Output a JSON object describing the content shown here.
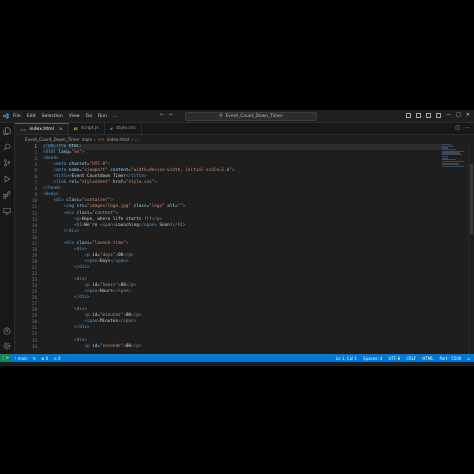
{
  "titlebar": {
    "menu": [
      "File",
      "Edit",
      "Selection",
      "View",
      "Go",
      "Run",
      "…"
    ],
    "nav_back": "←",
    "nav_forward": "→",
    "command_center": "Event_Count_Down_Timer"
  },
  "tabs": [
    {
      "label": "index.html",
      "icon": "<>",
      "icon_color": "#e37933",
      "active": true
    },
    {
      "label": "script.js",
      "icon": "JS",
      "icon_color": "#d4bf3a",
      "active": false
    },
    {
      "label": "style.css",
      "icon": "#",
      "icon_color": "#519aba",
      "active": false
    }
  ],
  "tab_close": "×",
  "breadcrumbs": [
    "Event_Count_Down_Timer",
    "main",
    "›",
    "<>",
    "index.html",
    "›",
    "..."
  ],
  "line_numbers": [
    "1",
    "2",
    "3",
    "4",
    "5",
    "6",
    "7",
    "8",
    "9",
    "10",
    "11",
    "12",
    "13",
    "14",
    "15",
    "16",
    "17",
    "18",
    "19",
    "20",
    "21",
    "22",
    "23",
    "24",
    "25",
    "26",
    "27",
    "28",
    "29",
    "30",
    "31",
    "32",
    "33",
    "34"
  ],
  "current_line": 1,
  "code": [
    [
      [
        "t-punc",
        "<!"
      ],
      [
        "t-tag",
        "DOCTYPE"
      ],
      [
        "t-attr",
        " html"
      ],
      [
        "t-punc",
        ">"
      ]
    ],
    [
      [
        "t-punc",
        "<"
      ],
      [
        "t-tag",
        "html"
      ],
      [
        "t-attr",
        " lang"
      ],
      [
        "t-txt",
        "="
      ],
      [
        "t-str",
        "\"en\""
      ],
      [
        "t-punc",
        ">"
      ]
    ],
    [
      [
        "t-punc",
        "<"
      ],
      [
        "t-tag",
        "head"
      ],
      [
        "t-punc",
        ">"
      ]
    ],
    [
      [
        "t-txt",
        "    "
      ],
      [
        "t-punc",
        "<"
      ],
      [
        "t-tag",
        "meta"
      ],
      [
        "t-attr",
        " charset"
      ],
      [
        "t-txt",
        "="
      ],
      [
        "t-str",
        "\"UTF-8\""
      ],
      [
        "t-punc",
        ">"
      ]
    ],
    [
      [
        "t-txt",
        "    "
      ],
      [
        "t-punc",
        "<"
      ],
      [
        "t-tag",
        "meta"
      ],
      [
        "t-attr",
        " name"
      ],
      [
        "t-txt",
        "="
      ],
      [
        "t-str",
        "\"viewport\""
      ],
      [
        "t-attr",
        " content"
      ],
      [
        "t-txt",
        "="
      ],
      [
        "t-str",
        "\"width=device-width, initial-scale=1.0\""
      ],
      [
        "t-punc",
        ">"
      ]
    ],
    [
      [
        "t-txt",
        "    "
      ],
      [
        "t-punc",
        "<"
      ],
      [
        "t-tag",
        "title"
      ],
      [
        "t-punc",
        ">"
      ],
      [
        "t-txt",
        "Event Countdown Timer"
      ],
      [
        "t-punc",
        "</"
      ],
      [
        "t-tag",
        "title"
      ],
      [
        "t-punc",
        ">"
      ]
    ],
    [
      [
        "t-txt",
        "    "
      ],
      [
        "t-punc",
        "<"
      ],
      [
        "t-tag",
        "link"
      ],
      [
        "t-attr",
        " rel"
      ],
      [
        "t-txt",
        "="
      ],
      [
        "t-str",
        "\"stylesheet\""
      ],
      [
        "t-attr",
        " href"
      ],
      [
        "t-txt",
        "="
      ],
      [
        "t-str",
        "\"style.css\""
      ],
      [
        "t-punc",
        ">"
      ]
    ],
    [
      [
        "t-punc",
        "</"
      ],
      [
        "t-tag",
        "head"
      ],
      [
        "t-punc",
        ">"
      ]
    ],
    [
      [
        "t-punc",
        "<"
      ],
      [
        "t-tag",
        "body"
      ],
      [
        "t-punc",
        ">"
      ]
    ],
    [
      [
        "t-txt",
        "    "
      ],
      [
        "t-punc",
        "<"
      ],
      [
        "t-tag",
        "div"
      ],
      [
        "t-attr",
        " class"
      ],
      [
        "t-txt",
        "="
      ],
      [
        "t-str",
        "\"container\""
      ],
      [
        "t-punc",
        ">"
      ]
    ],
    [
      [
        "t-txt",
        "        "
      ],
      [
        "t-punc",
        "<"
      ],
      [
        "t-tag",
        "img"
      ],
      [
        "t-attr",
        " src"
      ],
      [
        "t-txt",
        "="
      ],
      [
        "t-str",
        "\"images/logo.jpg\""
      ],
      [
        "t-attr",
        " class"
      ],
      [
        "t-txt",
        "="
      ],
      [
        "t-str",
        "\"logo\""
      ],
      [
        "t-attr",
        " alt"
      ],
      [
        "t-txt",
        "="
      ],
      [
        "t-str",
        "\"\""
      ],
      [
        "t-punc",
        ">"
      ]
    ],
    [
      [
        "t-txt",
        "        "
      ],
      [
        "t-punc",
        "<"
      ],
      [
        "t-tag",
        "div"
      ],
      [
        "t-attr",
        " class"
      ],
      [
        "t-txt",
        "="
      ],
      [
        "t-str",
        "\"content\""
      ],
      [
        "t-punc",
        ">"
      ]
    ],
    [
      [
        "t-txt",
        "            "
      ],
      [
        "t-punc",
        "<"
      ],
      [
        "t-tag",
        "p"
      ],
      [
        "t-punc",
        ">"
      ],
      [
        "t-txt",
        "Hope, where life starts !!!"
      ],
      [
        "t-punc",
        "</"
      ],
      [
        "t-tag",
        "p"
      ],
      [
        "t-punc",
        ">"
      ]
    ],
    [
      [
        "t-txt",
        "            "
      ],
      [
        "t-punc",
        "<"
      ],
      [
        "t-tag",
        "h1"
      ],
      [
        "t-punc",
        ">"
      ],
      [
        "t-txt",
        "We're "
      ],
      [
        "t-punc",
        "<"
      ],
      [
        "t-tag",
        "span"
      ],
      [
        "t-punc",
        ">"
      ],
      [
        "t-txt",
        "Launching"
      ],
      [
        "t-punc",
        "</"
      ],
      [
        "t-tag",
        "span"
      ],
      [
        "t-punc",
        ">"
      ],
      [
        "t-txt",
        " Soon!"
      ],
      [
        "t-punc",
        "</"
      ],
      [
        "t-tag",
        "h1"
      ],
      [
        "t-punc",
        ">"
      ]
    ],
    [
      [
        "t-txt",
        "        "
      ],
      [
        "t-punc",
        "</"
      ],
      [
        "t-tag",
        "div"
      ],
      [
        "t-punc",
        ">"
      ]
    ],
    [
      [
        "t-txt",
        ""
      ]
    ],
    [
      [
        "t-txt",
        "        "
      ],
      [
        "t-punc",
        "<"
      ],
      [
        "t-tag",
        "div"
      ],
      [
        "t-attr",
        " class"
      ],
      [
        "t-txt",
        "="
      ],
      [
        "t-str",
        "\"launch-time\""
      ],
      [
        "t-punc",
        ">"
      ]
    ],
    [
      [
        "t-txt",
        "            "
      ],
      [
        "t-punc",
        "<"
      ],
      [
        "t-tag",
        "div"
      ],
      [
        "t-punc",
        ">"
      ]
    ],
    [
      [
        "t-txt",
        "                "
      ],
      [
        "t-punc",
        "<"
      ],
      [
        "t-tag",
        "p"
      ],
      [
        "t-attr",
        " id"
      ],
      [
        "t-txt",
        "="
      ],
      [
        "t-str",
        "\"days\""
      ],
      [
        "t-punc",
        ">"
      ],
      [
        "t-txt",
        "00"
      ],
      [
        "t-punc",
        "</"
      ],
      [
        "t-tag",
        "p"
      ],
      [
        "t-punc",
        ">"
      ]
    ],
    [
      [
        "t-txt",
        "                "
      ],
      [
        "t-punc",
        "<"
      ],
      [
        "t-tag",
        "span"
      ],
      [
        "t-punc",
        ">"
      ],
      [
        "t-txt",
        "Days"
      ],
      [
        "t-punc",
        "</"
      ],
      [
        "t-tag",
        "span"
      ],
      [
        "t-punc",
        ">"
      ]
    ],
    [
      [
        "t-txt",
        "            "
      ],
      [
        "t-punc",
        "</"
      ],
      [
        "t-tag",
        "div"
      ],
      [
        "t-punc",
        ">"
      ]
    ],
    [
      [
        "t-txt",
        ""
      ]
    ],
    [
      [
        "t-txt",
        "            "
      ],
      [
        "t-punc",
        "<"
      ],
      [
        "t-tag",
        "div"
      ],
      [
        "t-punc",
        ">"
      ]
    ],
    [
      [
        "t-txt",
        "                "
      ],
      [
        "t-punc",
        "<"
      ],
      [
        "t-tag",
        "p"
      ],
      [
        "t-attr",
        " id"
      ],
      [
        "t-txt",
        "="
      ],
      [
        "t-str",
        "\"hours\""
      ],
      [
        "t-punc",
        ">"
      ],
      [
        "t-txt",
        "00"
      ],
      [
        "t-punc",
        "</"
      ],
      [
        "t-tag",
        "p"
      ],
      [
        "t-punc",
        ">"
      ]
    ],
    [
      [
        "t-txt",
        "                "
      ],
      [
        "t-punc",
        "<"
      ],
      [
        "t-tag",
        "span"
      ],
      [
        "t-punc",
        ">"
      ],
      [
        "t-txt",
        "Hours"
      ],
      [
        "t-punc",
        "</"
      ],
      [
        "t-tag",
        "span"
      ],
      [
        "t-punc",
        ">"
      ]
    ],
    [
      [
        "t-txt",
        "            "
      ],
      [
        "t-punc",
        "</"
      ],
      [
        "t-tag",
        "div"
      ],
      [
        "t-punc",
        ">"
      ]
    ],
    [
      [
        "t-txt",
        ""
      ]
    ],
    [
      [
        "t-txt",
        "            "
      ],
      [
        "t-punc",
        "<"
      ],
      [
        "t-tag",
        "div"
      ],
      [
        "t-punc",
        ">"
      ]
    ],
    [
      [
        "t-txt",
        "                "
      ],
      [
        "t-punc",
        "<"
      ],
      [
        "t-tag",
        "p"
      ],
      [
        "t-attr",
        " id"
      ],
      [
        "t-txt",
        "="
      ],
      [
        "t-str",
        "\"minutes\""
      ],
      [
        "t-punc",
        ">"
      ],
      [
        "t-txt",
        "00"
      ],
      [
        "t-punc",
        "</"
      ],
      [
        "t-tag",
        "p"
      ],
      [
        "t-punc",
        ">"
      ]
    ],
    [
      [
        "t-txt",
        "                "
      ],
      [
        "t-punc",
        "<"
      ],
      [
        "t-tag",
        "span"
      ],
      [
        "t-punc",
        ">"
      ],
      [
        "t-txt",
        "Minutes"
      ],
      [
        "t-punc",
        "</"
      ],
      [
        "t-tag",
        "span"
      ],
      [
        "t-punc",
        ">"
      ]
    ],
    [
      [
        "t-txt",
        "            "
      ],
      [
        "t-punc",
        "</"
      ],
      [
        "t-tag",
        "div"
      ],
      [
        "t-punc",
        ">"
      ]
    ],
    [
      [
        "t-txt",
        ""
      ]
    ],
    [
      [
        "t-txt",
        "            "
      ],
      [
        "t-punc",
        "<"
      ],
      [
        "t-tag",
        "div"
      ],
      [
        "t-punc",
        ">"
      ]
    ],
    [
      [
        "t-txt",
        "                "
      ],
      [
        "t-punc",
        "<"
      ],
      [
        "t-tag",
        "p"
      ],
      [
        "t-attr",
        " id"
      ],
      [
        "t-txt",
        "="
      ],
      [
        "t-str",
        "\"seconds\""
      ],
      [
        "t-punc",
        ">"
      ],
      [
        "t-txt",
        "00"
      ],
      [
        "t-punc",
        "</"
      ],
      [
        "t-tag",
        "p"
      ],
      [
        "t-punc",
        ">"
      ]
    ]
  ],
  "status": {
    "branch": "main",
    "errors": "⊗ 0",
    "warnings": "⚠ 0",
    "sync": "↻",
    "position": "Ln 1, Col 1",
    "spaces": "Spaces: 4",
    "encoding": "UTF-8",
    "eol": "CRLF",
    "language": "HTML",
    "port": "Port : 5500",
    "bell": "⌂"
  },
  "colors": {
    "status_bar": "#0078d4",
    "remote": "#16825d",
    "editor_bg": "#1e1e1e"
  }
}
